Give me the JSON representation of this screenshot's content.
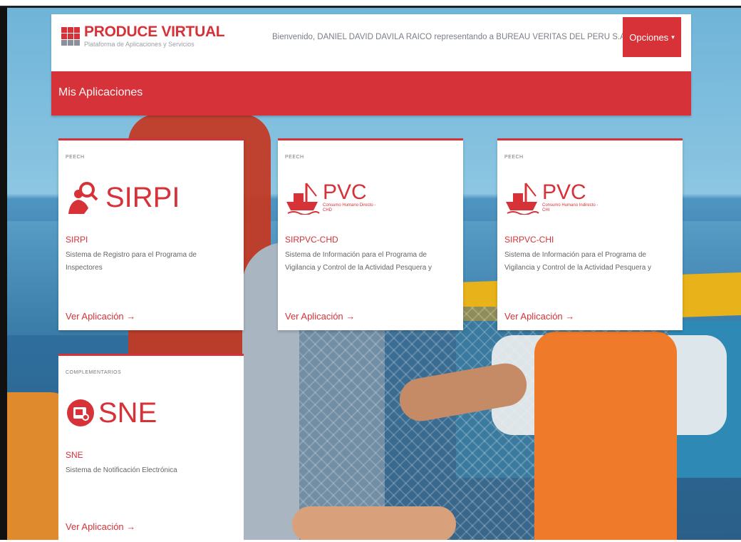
{
  "brand": {
    "title": "PRODUCE VIRTUAL",
    "subtitle": "Plataforma de Aplicaciones y Servicios"
  },
  "header": {
    "welcome": "Bienvenido, DANIEL DAVID DAVILA RAICO representando a BUREAU VERITAS DEL PERU S.A.",
    "options_label": "Opciones",
    "options_caret": "▾"
  },
  "apps_bar": {
    "title": "Mis Aplicaciones"
  },
  "colors": {
    "accent": "#d63238",
    "text_muted": "#7a7f87"
  },
  "cards": [
    {
      "category": "PEECH",
      "logo_text": "SIRPI",
      "logo_icon": "inspector-magnifier-icon",
      "name": "SIRPI",
      "description": "Sistema de Registro para el Programa de Inspectores",
      "link": "Ver Aplicación →"
    },
    {
      "category": "PEECH",
      "logo_text": "PVC",
      "logo_sub": "Consumo Humano Directo - CHD",
      "logo_icon": "fishing-boat-icon",
      "name": "SIRPVC-CHD",
      "description": "Sistema de Información para el Programa de Vigilancia y Control de la Actividad Pesquera y",
      "link": "Ver Aplicación →"
    },
    {
      "category": "PEECH",
      "logo_text": "PVC",
      "logo_sub": "Consumo Humano Indirecto - CHI",
      "logo_icon": "fishing-boat-icon",
      "name": "SIRPVC-CHI",
      "description": "Sistema de Información para el Programa de Vigilancia y Control de la Actividad Pesquera y",
      "link": "Ver Aplicación →"
    },
    {
      "category": "COMPLEMENTARIOS",
      "logo_text": "SNE",
      "logo_icon": "notification-mail-icon",
      "name": "SNE",
      "description": "Sistema de Notificación Electrónica",
      "link": "Ver Aplicación →"
    }
  ]
}
